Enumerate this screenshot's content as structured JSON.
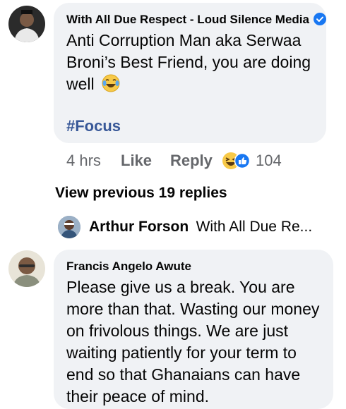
{
  "comment1": {
    "author": "With All Due Respect - Loud Silence Media",
    "text": "Anti Corruption Man aka Serwaa Broni’s Best Friend, you are doing well",
    "hashtag": "#Focus",
    "time": "4 hrs",
    "like_label": "Like",
    "reply_label": "Reply",
    "reaction_count": "104",
    "verified_icon": "verified-badge-icon",
    "emoji_icon": "laughing-tears-emoji",
    "reaction_icons": [
      "haha-reaction-icon",
      "like-reaction-icon"
    ]
  },
  "view_previous": "View previous 19 replies",
  "reply_preview": {
    "name": "Arthur Forson",
    "snippet": "With All Due Re..."
  },
  "comment2": {
    "author": "Francis Angelo Awute",
    "lines": [
      "Please give us a break. You are",
      "more than that. Wasting our money",
      "on frivolous things. We are just",
      "waiting patiently for your term to",
      "end so that Ghanaians can have",
      "their peace of mind."
    ]
  },
  "colors": {
    "bubble": "#f0f2f5",
    "link": "#385898",
    "meta": "#65676b",
    "verified": "#1877f2"
  }
}
